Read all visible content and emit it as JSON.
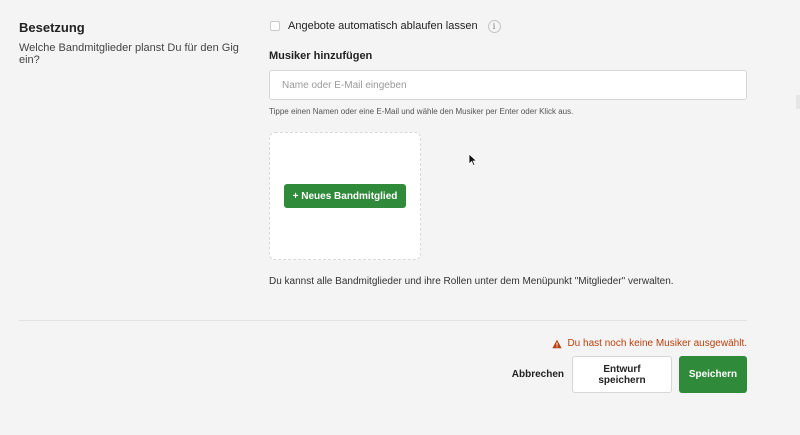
{
  "section": {
    "title": "Besetzung",
    "description": "Welche Bandmitglieder planst Du für den Gig ein?"
  },
  "auto_expire": {
    "label": "Angebote automatisch ablaufen lassen",
    "checked": false,
    "info_glyph": "i"
  },
  "add_musician": {
    "label": "Musiker hinzufügen",
    "value": "",
    "placeholder": "Name oder E-Mail eingeben",
    "hint": "Tippe einen Namen oder eine E-Mail und wähle den Musiker per Enter oder Klick aus."
  },
  "new_member": {
    "button_label": "+ Neues Bandmitglied"
  },
  "manage_note": "Du kannst alle Bandmitglieder und ihre Rollen unter dem Menüpunkt \"Mitglieder\" verwalten.",
  "footer": {
    "warning": "Du hast noch keine Musiker ausgewählt.",
    "cancel_label": "Abbrechen",
    "draft_label": "Entwurf speichern",
    "save_label": "Speichern"
  },
  "colors": {
    "primary": "#2f8a3a",
    "warning": "#b8400f",
    "background": "#f4f4f4"
  },
  "icons": {
    "info": "info-icon",
    "warning": "warning-triangle-icon",
    "cursor": "mouse-pointer-icon"
  }
}
